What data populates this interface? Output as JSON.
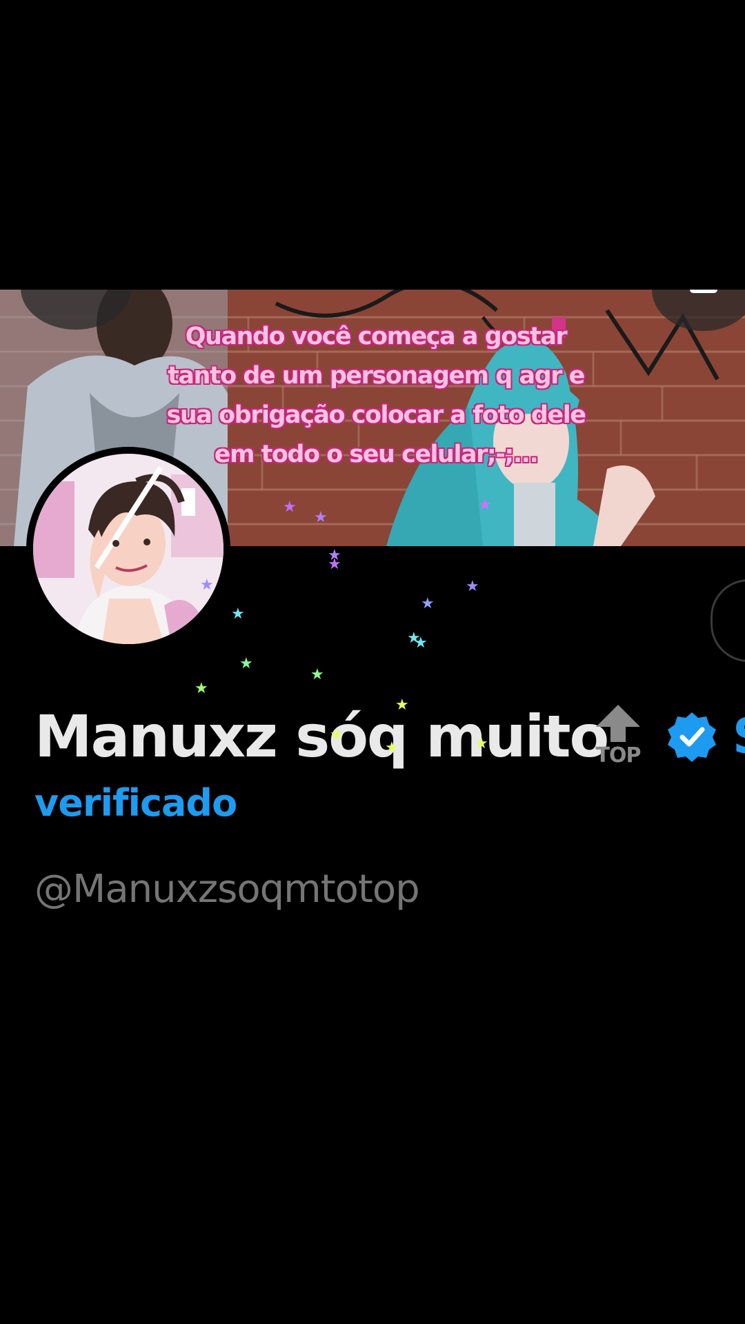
{
  "banner": {
    "caption_lines": [
      "Quando você começa a gostar",
      "tanto de um personagem q agr e",
      "sua obrigação colocar a foto dele",
      "em todo o seu celular;-;..."
    ]
  },
  "profile": {
    "display_name": "Manuxz sóq muito",
    "top_badge_label": "TOP",
    "name_overflow": "S",
    "verified_label": "verificado",
    "handle": "@Manuxzsoqmtotop"
  },
  "colors": {
    "background": "#000000",
    "caption_fill": "#ffc2e3",
    "caption_outline": "#c2287a",
    "verified_blue": "#1d9bf0",
    "name_white": "#e9e9e9",
    "handle_gray": "#757575"
  },
  "icons": {
    "verified": "verified-badge-icon",
    "top": "top-arrow-icon"
  }
}
